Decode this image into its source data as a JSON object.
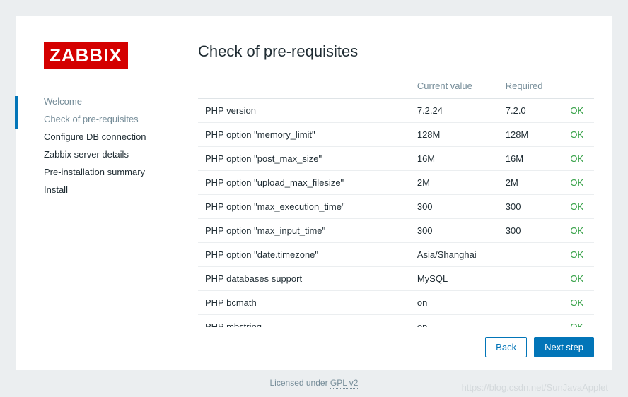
{
  "logo": "ZABBIX",
  "sidebar": {
    "items": [
      {
        "label": "Welcome",
        "state": "done"
      },
      {
        "label": "Check of pre-requisites",
        "state": "active"
      },
      {
        "label": "Configure DB connection",
        "state": ""
      },
      {
        "label": "Zabbix server details",
        "state": ""
      },
      {
        "label": "Pre-installation summary",
        "state": ""
      },
      {
        "label": "Install",
        "state": ""
      }
    ]
  },
  "main": {
    "title": "Check of pre-requisites",
    "headers": {
      "name": "",
      "current": "Current value",
      "required": "Required",
      "status": ""
    },
    "rows": [
      {
        "name": "PHP version",
        "current": "7.2.24",
        "required": "7.2.0",
        "status": "OK"
      },
      {
        "name": "PHP option \"memory_limit\"",
        "current": "128M",
        "required": "128M",
        "status": "OK"
      },
      {
        "name": "PHP option \"post_max_size\"",
        "current": "16M",
        "required": "16M",
        "status": "OK"
      },
      {
        "name": "PHP option \"upload_max_filesize\"",
        "current": "2M",
        "required": "2M",
        "status": "OK"
      },
      {
        "name": "PHP option \"max_execution_time\"",
        "current": "300",
        "required": "300",
        "status": "OK"
      },
      {
        "name": "PHP option \"max_input_time\"",
        "current": "300",
        "required": "300",
        "status": "OK"
      },
      {
        "name": "PHP option \"date.timezone\"",
        "current": "Asia/Shanghai",
        "required": "",
        "status": "OK"
      },
      {
        "name": "PHP databases support",
        "current": "MySQL",
        "required": "",
        "status": "OK"
      },
      {
        "name": "PHP bcmath",
        "current": "on",
        "required": "",
        "status": "OK"
      },
      {
        "name": "PHP mbstring",
        "current": "on",
        "required": "",
        "status": "OK"
      }
    ]
  },
  "buttons": {
    "back": "Back",
    "next": "Next step"
  },
  "footer": {
    "licensed": "Licensed under ",
    "license_link": "GPL v2"
  },
  "watermark": "https://blog.csdn.net/SunJavaApplet"
}
